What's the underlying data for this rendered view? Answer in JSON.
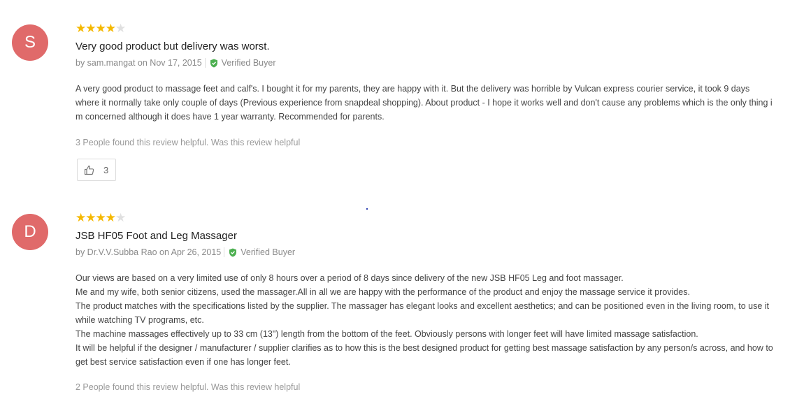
{
  "reviews": [
    {
      "avatar_letter": "S",
      "rating": 4,
      "title": "Very good product but delivery was worst.",
      "byline": "by sam.mangat on Nov 17, 2015",
      "verified_label": "Verified Buyer",
      "paragraphs": [
        "A very good product to massage feet and calf's. I bought it for my parents, they are happy with it. But the delivery was horrible by Vulcan express courier service, it took 9 days where it normally take only couple of days (Previous experience from snapdeal shopping). About product - I hope it works well and don't cause any problems which is the only thing i m concerned although it does have 1 year warranty. Recommended for parents."
      ],
      "helpful_text": "3 People found this review helpful. Was this review helpful",
      "helpful_count": "3"
    },
    {
      "avatar_letter": "D",
      "rating": 4,
      "title": "JSB HF05 Foot and Leg Massager",
      "byline": "by Dr.V.V.Subba Rao on Apr 26, 2015",
      "verified_label": "Verified Buyer",
      "paragraphs": [
        "Our views are based on a very limited use of only 8 hours over a period of 8 days since delivery of the new JSB HF05 Leg and foot massager.",
        "Me and my wife, both senior citizens, used the massager.All in all we are happy with the performance of the product and enjoy the massage service it provides.",
        "The product matches with the specifications listed by the supplier. The massager has elegant looks and excellent aesthetics; and can be positioned even in the living room, to use it while watching TV programs, etc.",
        "The machine massages effectively up to 33 cm (13\") length from the bottom of the feet. Obviously persons with longer feet will have limited massage satisfaction.",
        "It will be helpful if the designer / manufacturer / supplier clarifies  as to how this is the best designed product for getting best massage satisfaction by any person/s across, and how to get best service satisfaction even if one has longer feet."
      ],
      "helpful_text": "2 People found this review helpful. Was this review helpful"
    }
  ],
  "colors": {
    "avatar": "#e06a6a",
    "star_on": "#f5b800",
    "star_off": "#e0e0e0",
    "verified": "#4caf50"
  }
}
